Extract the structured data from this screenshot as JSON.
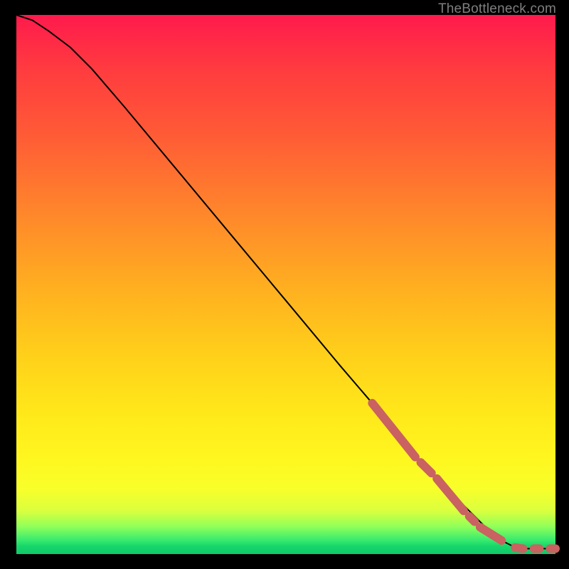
{
  "attribution": "TheBottleneck.com",
  "chart_data": {
    "type": "line",
    "title": "",
    "xlabel": "",
    "ylabel": "",
    "xlim": [
      0,
      100
    ],
    "ylim": [
      0,
      100
    ],
    "series": [
      {
        "name": "curve",
        "x": [
          0,
          3,
          6,
          10,
          14,
          20,
          30,
          40,
          50,
          60,
          66,
          70,
          74,
          78,
          82,
          86,
          88,
          90,
          92,
          94,
          96,
          98,
          100
        ],
        "y": [
          100,
          99,
          97,
          94,
          90,
          83,
          71,
          59,
          47,
          35,
          28,
          23,
          18,
          14,
          10,
          6,
          4,
          2.5,
          1.5,
          1,
          1,
          1,
          1
        ]
      }
    ],
    "markers": {
      "name": "highlighted-points",
      "color": "#c96260",
      "segments": [
        {
          "x0": 66,
          "y0": 28,
          "x1": 74,
          "y1": 18,
          "type": "capsule"
        },
        {
          "x0": 75,
          "y0": 17,
          "x1": 77,
          "y1": 15,
          "type": "capsule"
        },
        {
          "x0": 78,
          "y0": 14,
          "x1": 83,
          "y1": 8,
          "type": "capsule"
        },
        {
          "x0": 84,
          "y0": 7,
          "x1": 85,
          "y1": 6,
          "type": "capsule"
        },
        {
          "x0": 86,
          "y0": 5,
          "x1": 90,
          "y1": 2.5,
          "type": "capsule"
        },
        {
          "x0": 92.5,
          "y0": 1.2,
          "x1": 94,
          "y1": 1,
          "type": "capsule"
        },
        {
          "x0": 96,
          "y0": 1,
          "x1": 97,
          "y1": 1,
          "type": "capsule"
        },
        {
          "x0": 99,
          "y0": 1,
          "x1": 100,
          "y1": 1,
          "type": "capsule"
        }
      ]
    },
    "background_gradient": {
      "top": "#ff1a4d",
      "mid_upper": "#ff8a2a",
      "mid": "#ffe81a",
      "lower": "#8eff5a",
      "bottom": "#0fc96a"
    }
  }
}
